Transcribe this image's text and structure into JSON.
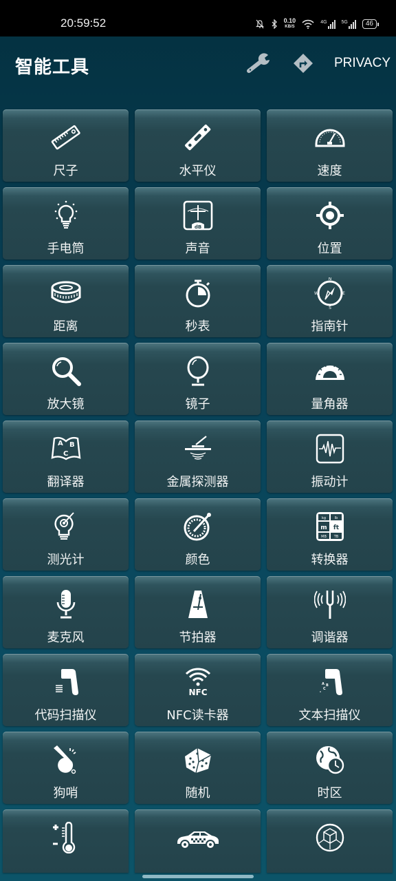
{
  "status_bar": {
    "time": "20:59:52",
    "net_speed_value": "0.10",
    "net_speed_unit": "KB/S",
    "signal_1_label": "4G",
    "signal_2_label": "5G",
    "battery": "46",
    "icons": [
      "mute-bell-icon",
      "bluetooth-icon",
      "wifi-icon",
      "signal-4g-icon",
      "signal-5g-icon",
      "battery-icon"
    ]
  },
  "app_bar": {
    "title": "智能工具",
    "settings_icon": "wrench-icon",
    "directions_icon": "turn-right-diamond-icon",
    "privacy_label": "PRIVACY"
  },
  "tools": [
    {
      "label": "尺子",
      "icon": "ruler-icon"
    },
    {
      "label": "水平仪",
      "icon": "spirit-level-icon"
    },
    {
      "label": "速度",
      "icon": "speedometer-icon"
    },
    {
      "label": "手电筒",
      "icon": "lightbulb-icon"
    },
    {
      "label": "声音",
      "icon": "db-meter-icon"
    },
    {
      "label": "位置",
      "icon": "location-crosshair-icon"
    },
    {
      "label": "距离",
      "icon": "tape-measure-icon"
    },
    {
      "label": "秒表",
      "icon": "stopwatch-icon"
    },
    {
      "label": "指南针",
      "icon": "compass-icon"
    },
    {
      "label": "放大镜",
      "icon": "magnifier-icon"
    },
    {
      "label": "镜子",
      "icon": "mirror-icon"
    },
    {
      "label": "量角器",
      "icon": "protractor-icon"
    },
    {
      "label": "翻译器",
      "icon": "abc-book-icon"
    },
    {
      "label": "金属探测器",
      "icon": "metal-detector-icon"
    },
    {
      "label": "振动计",
      "icon": "vibration-wave-icon"
    },
    {
      "label": "测光计",
      "icon": "light-meter-icon"
    },
    {
      "label": "颜色",
      "icon": "color-picker-icon"
    },
    {
      "label": "转换器",
      "icon": "unit-converter-icon"
    },
    {
      "label": "麦克风",
      "icon": "microphone-icon"
    },
    {
      "label": "节拍器",
      "icon": "metronome-icon"
    },
    {
      "label": "调谐器",
      "icon": "tuning-fork-icon"
    },
    {
      "label": "代码扫描仪",
      "icon": "barcode-scanner-icon"
    },
    {
      "label": "NFC读卡器",
      "icon": "nfc-icon"
    },
    {
      "label": "文本扫描仪",
      "icon": "text-scanner-icon"
    },
    {
      "label": "狗哨",
      "icon": "whistle-icon"
    },
    {
      "label": "随机",
      "icon": "dice-icon"
    },
    {
      "label": "时区",
      "icon": "globe-clock-icon"
    },
    {
      "label": "",
      "icon": "thermometer-icon"
    },
    {
      "label": "",
      "icon": "car-icon"
    },
    {
      "label": "",
      "icon": "3d-cube-icon"
    }
  ]
}
